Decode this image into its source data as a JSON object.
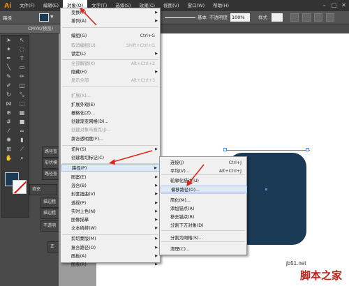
{
  "app": {
    "logo": "Ai"
  },
  "menubar": {
    "items": [
      "文件(F)",
      "编辑(E)",
      "对象(O)",
      "文字(T)",
      "选择(S)",
      "效果(C)",
      "视图(V)",
      "窗口(W)",
      "帮助(H)"
    ],
    "active_index": 2
  },
  "controlbar": {
    "path_label": "路径",
    "basic": "基本",
    "opacity_label": "不透明度",
    "opacity_value": "100%",
    "style_label": "样式"
  },
  "document": {
    "tab_title": "CMYK/预览)"
  },
  "panels": {
    "tabs": [
      "路径查",
      "形状模",
      "路径查",
      "填充",
      "描边粗",
      "描边粗",
      "不透明",
      "正"
    ]
  },
  "object_menu": {
    "items": [
      {
        "label": "变换(T)",
        "arrow": true
      },
      {
        "label": "排列(A)",
        "arrow": true
      },
      {
        "label": "编组(G)",
        "shortcut": "Ctrl+G"
      },
      {
        "label": "取消编组(U)",
        "shortcut": "Shift+Ctrl+G",
        "disabled": true
      },
      {
        "label": "锁定(L)",
        "arrow": true
      },
      {
        "label": "全部解锁(K)",
        "shortcut": "Alt+Ctrl+2",
        "disabled": true
      },
      {
        "label": "隐藏(H)",
        "arrow": true
      },
      {
        "label": "显示全部",
        "shortcut": "Alt+Ctrl+3",
        "disabled": true
      },
      {
        "label": "扩展(X)...",
        "disabled": true
      },
      {
        "label": "扩展外观(E)"
      },
      {
        "label": "栅格化(Z)..."
      },
      {
        "label": "创建渐变网格(D)..."
      },
      {
        "label": "创建对象马赛克(J)...",
        "disabled": true
      },
      {
        "label": "拼合透明度(F)..."
      },
      {
        "label": "切片(S)",
        "arrow": true
      },
      {
        "label": "创建裁切标记(C)"
      },
      {
        "label": "路径(P)",
        "arrow": true,
        "highlighted": true
      },
      {
        "label": "图案(E)",
        "arrow": true
      },
      {
        "label": "混合(B)",
        "arrow": true
      },
      {
        "label": "封套扭曲(V)",
        "arrow": true
      },
      {
        "label": "透视(P)",
        "arrow": true
      },
      {
        "label": "实时上色(N)",
        "arrow": true
      },
      {
        "label": "图像描摹",
        "arrow": true
      },
      {
        "label": "文本绕排(W)",
        "arrow": true
      },
      {
        "label": "剪切蒙版(M)",
        "arrow": true
      },
      {
        "label": "复合路径(O)",
        "arrow": true
      },
      {
        "label": "画板(A)",
        "arrow": true
      },
      {
        "label": "图表(R)",
        "arrow": true
      }
    ]
  },
  "path_submenu": {
    "items": [
      {
        "label": "连接(J)",
        "shortcut": "Ctrl+J"
      },
      {
        "label": "平均(V)...",
        "shortcut": "Alt+Ctrl+J"
      },
      {
        "label": "轮廓化描边(U)"
      },
      {
        "label": "偏移路径(O)...",
        "highlighted": true
      },
      {
        "label": "简化(M)..."
      },
      {
        "label": "添加锚点(A)"
      },
      {
        "label": "移去锚点(R)"
      },
      {
        "label": "分割下方对象(D)"
      },
      {
        "label": "分割为网格(S)..."
      },
      {
        "label": "清理(C)..."
      }
    ]
  },
  "colors": {
    "fill": "#1b3a56",
    "highlight": "#dde8f5",
    "arrow": "#e2231a",
    "menu_bg": "#f0f0f0"
  },
  "watermark": {
    "url": "jb51.net",
    "text": "脚本之家"
  }
}
